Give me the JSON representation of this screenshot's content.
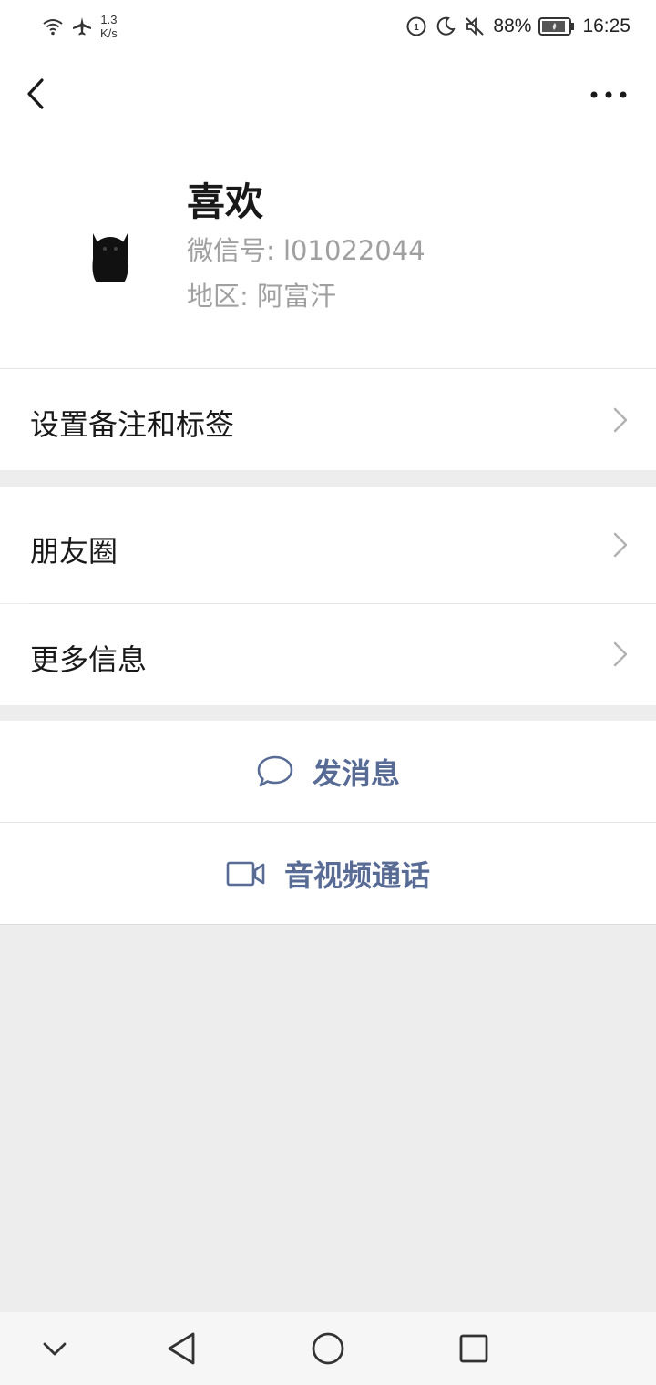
{
  "status_bar": {
    "speed_value": "1.3",
    "speed_unit": "K/s",
    "battery": "88%",
    "time": "16:25",
    "icons": [
      "wifi-icon",
      "airplane-icon",
      "hd-icon",
      "moon-icon",
      "mute-icon",
      "battery-icon"
    ]
  },
  "header": {
    "back_icon": "chevron-left-icon",
    "more_icon": "more-dots-icon"
  },
  "profile": {
    "name": "喜欢",
    "wechat_id": "微信号: l01022044",
    "region": "地区: 阿富汗"
  },
  "menu": {
    "remark_tags": "设置备注和标签",
    "moments": "朋友圈",
    "more_info": "更多信息"
  },
  "actions": {
    "send_message": "发消息",
    "video_call": "音视频通话"
  },
  "colors": {
    "accent": "#576b95",
    "background": "#ededed",
    "secondary_text": "#a0a0a0"
  }
}
